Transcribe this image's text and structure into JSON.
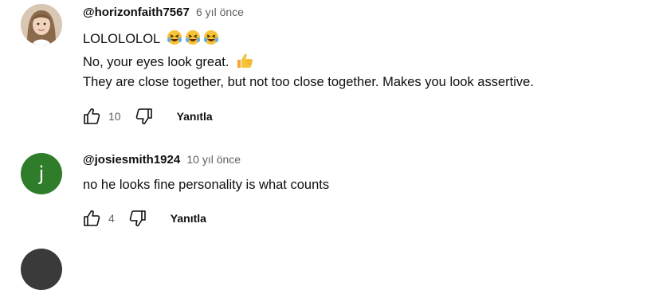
{
  "comments": [
    {
      "handle": "@horizonfaith7567",
      "time": "6 yıl önce",
      "lines": [
        "LOLOLOLOL",
        "No, your eyes look great.",
        "They are close together, but not too close together. Makes you look assertive."
      ],
      "likes": "10",
      "reply_label": "Yanıtla",
      "emoji_line1": "laughing-emoji x3",
      "emoji_line2": "thumbs-up-emoji"
    },
    {
      "avatar_letter": "j",
      "handle": "@josiesmith1924",
      "time": "10 yıl önce",
      "lines": [
        "no he looks fine personality is what counts"
      ],
      "likes": "4",
      "reply_label": "Yanıtla",
      "avatar_color": "#2f7d2a"
    }
  ]
}
